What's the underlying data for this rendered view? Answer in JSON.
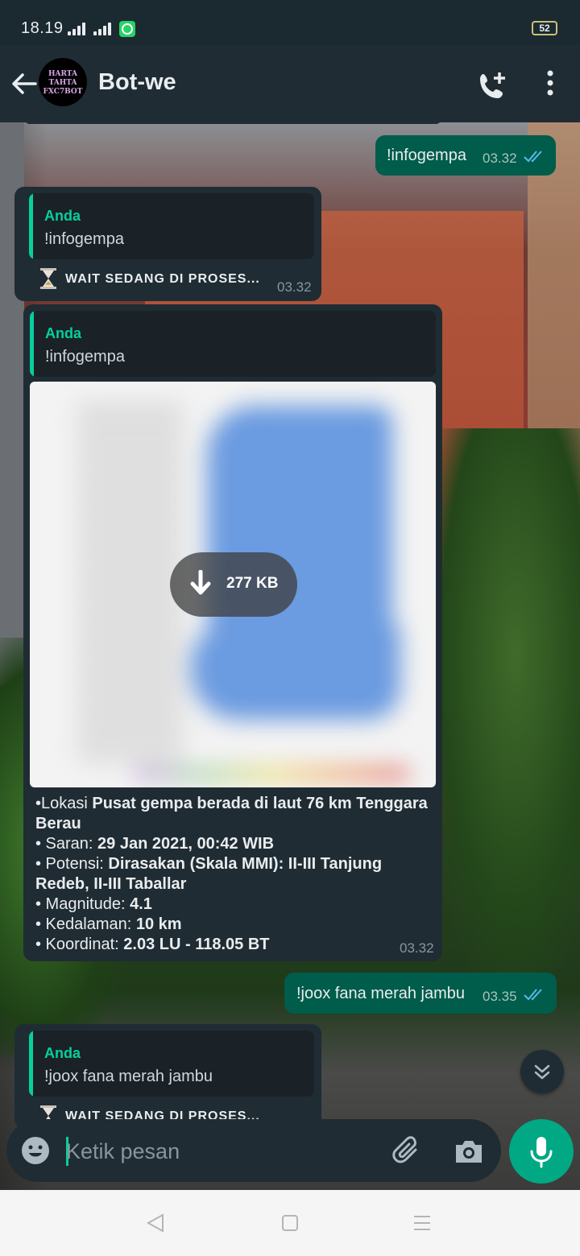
{
  "status_bar": {
    "time": "18.19",
    "battery": "52"
  },
  "header": {
    "avatar_text": [
      "HARTA",
      "TAHTA",
      "FXC7BOT"
    ],
    "title": "Bot-we"
  },
  "messages": {
    "m1": {
      "text": "!infogempa",
      "time": "03.32"
    },
    "m2": {
      "quote_name": "Anda",
      "quote_text": "!infogempa",
      "text": "WAIT SEDANG DI PROSES...",
      "time": "03.32"
    },
    "m3": {
      "quote_name": "Anda",
      "quote_text": "!infogempa",
      "image_size": "277 KB",
      "caption": [
        {
          "label": "•Lokasi ",
          "value": "Pusat gempa berada di laut 76 km Tenggara Berau"
        },
        {
          "label": "• Saran: ",
          "value": "29 Jan 2021, 00:42 WIB"
        },
        {
          "label": "• Potensi: ",
          "value": "Dirasakan (Skala MMI): II-III Tanjung Redeb, II-III Taballar"
        },
        {
          "label": "• Magnitude: ",
          "value": "4.1"
        },
        {
          "label": "• Kedalaman: ",
          "value": "10 km"
        },
        {
          "label": "• Koordinat: ",
          "value": "2.03 LU - 118.05 BT"
        }
      ],
      "time": "03.32"
    },
    "m4": {
      "text": "!joox fana merah jambu",
      "time": "03.35"
    },
    "m5": {
      "quote_name": "Anda",
      "quote_text": "!joox fana merah jambu",
      "text": "WAIT SEDANG DI PROSES..."
    }
  },
  "input": {
    "placeholder": "Ketik pesan"
  },
  "colors": {
    "accent": "#00a884",
    "outgoing_bubble": "#005c4b",
    "incoming_bubble": "#202c33",
    "read_ticks": "#53bdeb"
  }
}
